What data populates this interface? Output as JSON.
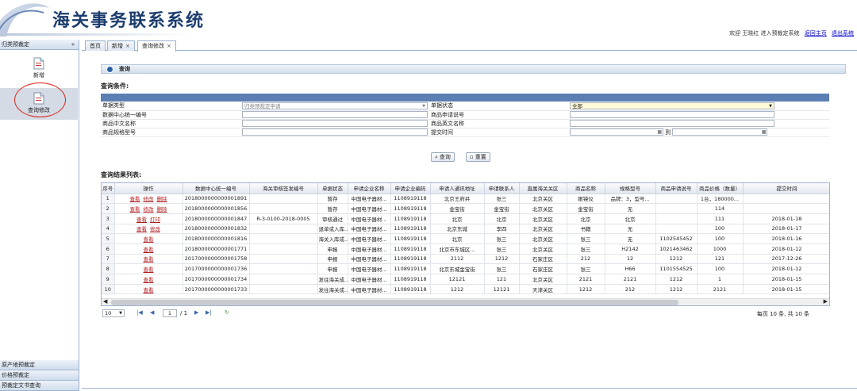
{
  "app": {
    "title": "海关事务联系系统",
    "welcome_text": "欢迎 王晓红 进入预裁定系统",
    "home_link": "返回主页",
    "logout_link": "退出系统"
  },
  "sidebar": {
    "section_title": "归类预裁定",
    "toggle": "«",
    "items": [
      {
        "label": "新增",
        "icon": "document-icon"
      },
      {
        "label": "查询修改",
        "icon": "document-edit-icon"
      }
    ],
    "bottom_sections": [
      "原产地预裁定",
      "价格预裁定",
      "预裁定文书查询"
    ]
  },
  "tabs": [
    {
      "label": "首页",
      "closable": false
    },
    {
      "label": "新增",
      "closable": true
    },
    {
      "label": "查询修改",
      "closable": true
    }
  ],
  "panel": {
    "title": "查询"
  },
  "query": {
    "section_title": "查询条件:",
    "fields": {
      "doc_type_label": "单据类型",
      "doc_type_value": "归类预裁定申请",
      "status_label": "单据状态",
      "status_value": "全部",
      "data_no_label": "数据中心统一编号",
      "apply_no_label": "商品申请说号",
      "cn_name_label": "商品中文名称",
      "en_name_label": "商品英文名称",
      "spec_label": "商品规格型号",
      "submit_time_label": "提交时间",
      "to_label": "到"
    },
    "search_button": "查询",
    "reset_button": "重置"
  },
  "results": {
    "section_title": "查询结果列表:",
    "columns": [
      "序号",
      "操作",
      "数据中心统一编号",
      "海关审核签发编号",
      "单据状态",
      "申请企业名称",
      "申请企业编码",
      "申请人通讯地址",
      "申请联系人",
      "直属海关关区",
      "商品名称",
      "规格型号",
      "商品申请说号",
      "商品价格（数量）",
      "提交时间"
    ],
    "rows": [
      {
        "no": "1",
        "ops": [
          "查看",
          "修改",
          "删除"
        ],
        "data_no": "2018000000000001891",
        "customs_no": "",
        "status": "暂存",
        "company": "中国电子器材...",
        "code": "1108919118",
        "addr": "北京王府井",
        "contact": "张三",
        "district": "北京关区",
        "name": "眼镜仪",
        "spec": "品牌：3，型号...",
        "apply_no": "",
        "price": "1台，180000...",
        "time": ""
      },
      {
        "no": "2",
        "ops": [
          "查看",
          "修改",
          "删除"
        ],
        "data_no": "2018000000000001856",
        "customs_no": "",
        "status": "暂存",
        "company": "中国电子器材...",
        "code": "1108919118",
        "addr": "金宝街",
        "contact": "金宝街",
        "district": "北京关区",
        "name": "金宝街",
        "spec": "无",
        "apply_no": "",
        "price": "114",
        "time": ""
      },
      {
        "no": "3",
        "ops": [
          "查看",
          "打印"
        ],
        "data_no": "2018000000000001847",
        "customs_no": "R-3-0100-2018-0005",
        "status": "审核通过",
        "company": "中国电子器材...",
        "code": "1108919118",
        "addr": "北京",
        "contact": "北京",
        "district": "北京关区",
        "name": "北京",
        "spec": "北京",
        "apply_no": "",
        "price": "111",
        "time": "2018-01-18"
      },
      {
        "no": "4",
        "ops": [
          "查看",
          "修改"
        ],
        "data_no": "2018000000000001832",
        "customs_no": "",
        "status": "退单或入库...",
        "company": "中国电子器材...",
        "code": "1108919118",
        "addr": "北京东城",
        "contact": "李四",
        "district": "北京关区",
        "name": "书籍",
        "spec": "无",
        "apply_no": "",
        "price": "100",
        "time": "2018-01-17"
      },
      {
        "no": "5",
        "ops": [
          "查看"
        ],
        "data_no": "2018000000000001816",
        "customs_no": "",
        "status": "海关入库成...",
        "company": "中国电子器材...",
        "code": "1108919118",
        "addr": "北京",
        "contact": "张三",
        "district": "北京关区",
        "name": "张三",
        "spec": "无",
        "apply_no": "1102545452",
        "price": "100",
        "time": "2018-01-16"
      },
      {
        "no": "6",
        "ops": [
          "查看"
        ],
        "data_no": "2018000000000001771",
        "customs_no": "",
        "status": "申报",
        "company": "中国电子器材...",
        "code": "1108919118",
        "addr": "北京市东城区...",
        "contact": "张三",
        "district": "北京关区",
        "name": "张三",
        "spec": "H2142",
        "apply_no": "1021463462",
        "price": "1000",
        "time": "2018-01-12"
      },
      {
        "no": "7",
        "ops": [
          "查看"
        ],
        "data_no": "2017000000000001758",
        "customs_no": "",
        "status": "申报",
        "company": "中国电子器材...",
        "code": "1108919118",
        "addr": "2112",
        "contact": "1212",
        "district": "石家庄区",
        "name": "212",
        "spec": "12",
        "apply_no": "1212",
        "price": "121",
        "time": "2017-12-26"
      },
      {
        "no": "8",
        "ops": [
          "查看"
        ],
        "data_no": "2017000000000001736",
        "customs_no": "",
        "status": "申报",
        "company": "中国电子器材...",
        "code": "1108919118",
        "addr": "北京东城金宝街",
        "contact": "张三",
        "district": "石家庄区",
        "name": "张三",
        "spec": "H66",
        "apply_no": "1101554525",
        "price": "100",
        "time": "2018-01-12"
      },
      {
        "no": "9",
        "ops": [
          "查看"
        ],
        "data_no": "2017000000000001734",
        "customs_no": "",
        "status": "发往海关成...",
        "company": "中国电子器材...",
        "code": "1108919118",
        "addr": "12121",
        "contact": "121",
        "district": "北京关区",
        "name": "2121",
        "spec": "2121",
        "apply_no": "1212",
        "price": "1",
        "time": "2018-01-15"
      },
      {
        "no": "10",
        "ops": [
          "查看"
        ],
        "data_no": "2017000000000001733",
        "customs_no": "",
        "status": "发往海关成...",
        "company": "中国电子器材...",
        "code": "1108919118",
        "addr": "1212",
        "contact": "12121",
        "district": "天津关区",
        "name": "1212",
        "spec": "212",
        "apply_no": "1212",
        "price": "2121",
        "time": "2018-01-15"
      }
    ]
  },
  "pager": {
    "page_size": "10",
    "current_page": "1",
    "total_pages": "/ 1",
    "info": "每页 10 条, 共 10 条"
  },
  "colors": {
    "link": "#b1191c",
    "header_bar": "#5b7fb3",
    "annotation_circle": "#d9241c"
  }
}
